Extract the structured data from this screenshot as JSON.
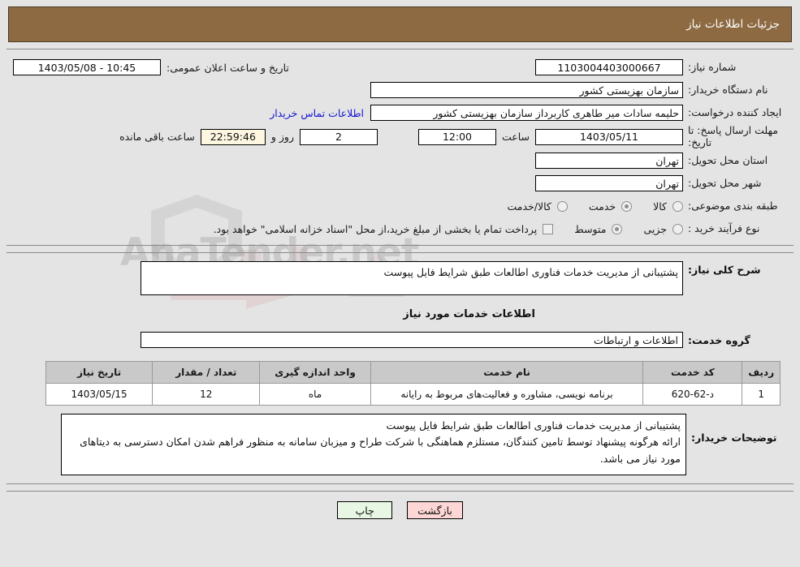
{
  "header": {
    "title": "جزئیات اطلاعات نیاز"
  },
  "top_form": {
    "need_no_label": "شماره نیاز:",
    "need_no_value": "1103004403000667",
    "public_announce_label": "تاریخ و ساعت اعلان عمومی:",
    "public_announce_value": "10:45 - 1403/05/08",
    "buyer_org_label": "نام دستگاه خریدار:",
    "buyer_org_value": "سازمان بهزیستی کشور",
    "creator_label": "ایجاد کننده درخواست:",
    "creator_value": "حلیمه سادات میر طاهری کاربرداز سازمان بهزیستی کشور",
    "contact_link": "اطلاعات تماس خریدار",
    "deadline_label": "مهلت ارسال پاسخ: تا تاریخ:",
    "deadline_date": "1403/05/11",
    "hour_label": "ساعت",
    "deadline_time": "12:00",
    "days_value": "2",
    "days_label": "روز و",
    "countdown_value": "22:59:46",
    "remaining_label": "ساعت باقی مانده",
    "province_label": "استان محل تحویل:",
    "province_value": "تهران",
    "city_label": "شهر محل تحویل:",
    "city_value": "تهران",
    "category_label": "طبقه بندی موضوعی:",
    "category_options": [
      {
        "label": "کالا",
        "selected": false
      },
      {
        "label": "خدمت",
        "selected": true
      },
      {
        "label": "کالا/خدمت",
        "selected": false
      }
    ],
    "process_label": "نوع فرآیند خرید :",
    "process_options": [
      {
        "label": "جزیی",
        "selected": false
      },
      {
        "label": "متوسط",
        "selected": true
      }
    ],
    "treasury_checkbox_checked": false,
    "treasury_note": "پرداخت تمام یا بخشی از مبلغ خرید،از محل \"اسناد خزانه اسلامی\" خواهد بود."
  },
  "middle": {
    "need_desc_label": "شرح کلی نیاز:",
    "need_desc_value": "پشتیبانی از مدیریت خدمات فناوری اطالعات طبق شرایط فایل پیوست",
    "section_title": "اطلاعات خدمات مورد نیاز",
    "service_group_label": "گروه خدمت:",
    "service_group_value": "اطلاعات و ارتباطات"
  },
  "table": {
    "headers": [
      "ردیف",
      "کد خدمت",
      "نام خدمت",
      "واحد اندازه گیری",
      "تعداد / مقدار",
      "تاریخ نیاز"
    ],
    "rows": [
      {
        "radif": "1",
        "code": "د-62-620",
        "name": "برنامه نویسی، مشاوره و فعالیت‌های مربوط به رایانه",
        "unit": "ماه",
        "qty": "12",
        "date": "1403/05/15"
      }
    ]
  },
  "notes": {
    "label": "توضیحات خریدار:",
    "value": "پشتیبانی از مدیریت خدمات فناوری اطالعات طبق شرایط فایل پیوست\nارائه هرگونه پیشنهاد توسط تامین کنندگان، مستلزم هماهنگی با شرکت طراح و میزبان سامانه به منظور فراهم شدن امکان دسترسی به دیتاهای مورد نیاز می باشد."
  },
  "footer": {
    "back_label": "بازگشت",
    "print_label": "چاپ"
  },
  "watermark": {
    "text": "AnaTender.net"
  },
  "colors": {
    "header_bg": "#8d6a42",
    "page_bg": "#e4e4e4",
    "link": "#1414d2",
    "table_header_bg": "#c9c9c9",
    "countdown_bg": "#fdf6e0",
    "back_btn_bg": "#ffd6d6",
    "print_btn_bg": "#e8f6e4"
  }
}
